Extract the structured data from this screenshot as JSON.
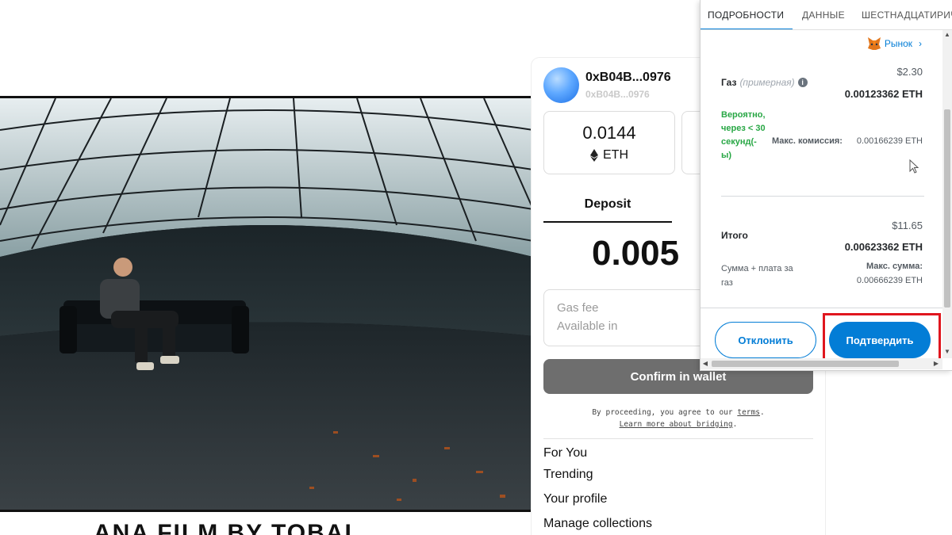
{
  "video": {
    "caption_partial": "ANA FILM BY TOBAL"
  },
  "bridge": {
    "account": {
      "name": "0xB04B...0976",
      "sub": "0xB04B...0976"
    },
    "balance": {
      "value": "0.0144",
      "unit": "ETH"
    },
    "tab_deposit": "Deposit",
    "amount": "0.005",
    "fee": {
      "gas_fee_label": "Gas fee",
      "available_label": "Available in"
    },
    "confirm_label": "Confirm in wallet",
    "terms": {
      "prefix": "By proceeding, you agree to our ",
      "terms_link": "terms",
      "suffix": ".",
      "learn_more": "Learn more about bridging",
      "learn_suffix": "."
    },
    "nav": [
      "For You",
      "Trending",
      "Your profile",
      "Manage collections"
    ]
  },
  "metamask": {
    "tabs": [
      "ПОДРОБНОСТИ",
      "ДАННЫЕ",
      "ШЕСТНАДЦАТИРИЧНЫЙ"
    ],
    "market_label": "Рынок",
    "gas": {
      "label": "Газ",
      "estimated": "(примерная)",
      "usd": "$2.30",
      "eth": "0.00123362 ETH"
    },
    "likely_text": "Вероятно, через < 30 секунд(-ы)",
    "max_fee_label": "Макс. комиссия:",
    "max_fee_value": "0.00166239 ETH",
    "total": {
      "label": "Итого",
      "usd": "$11.65",
      "eth": "0.00623362 ETH",
      "sum_label": "Сумма + плата за газ",
      "max_sum_label": "Макс. сумма:",
      "max_sum_value": "0.00666239 ETH"
    },
    "reject_label": "Отклонить",
    "confirm_label": "Подтвердить",
    "colors": {
      "primary": "#037dd6",
      "success": "#28a745",
      "highlight": "#e0161e"
    }
  }
}
